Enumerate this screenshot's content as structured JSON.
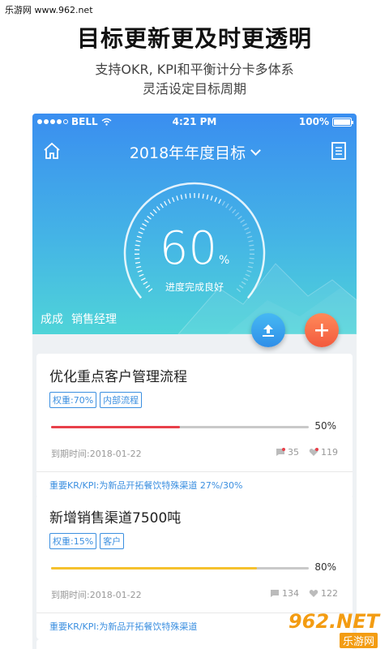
{
  "watermark": {
    "top_text": "乐游网 www.962.net",
    "logo_main": "962.NET",
    "logo_sub": "乐游网"
  },
  "promo": {
    "title": "目标更新更及时更透明",
    "subtitle_line1": "支持OKR, KPI和平衡计分卡多体系",
    "subtitle_line2": "灵活设定目标周期"
  },
  "status_bar": {
    "carrier": "BELL",
    "time": "4:21 PM",
    "battery": "100%"
  },
  "nav": {
    "title": "2018年年度目标",
    "home_icon": "home-icon",
    "doc_icon": "document-icon"
  },
  "gauge": {
    "value": "60",
    "unit": "%",
    "label": "进度完成良好",
    "progress": 0.6
  },
  "owner": {
    "name": "成成",
    "role": "销售经理"
  },
  "fabs": {
    "upload_icon": "upload-icon",
    "add_icon": "plus-icon"
  },
  "cards": [
    {
      "title": "优化重点客户管理流程",
      "tags": [
        "权重:70%",
        "内部流程"
      ],
      "progress": 0.5,
      "progress_label": "50%",
      "bar_color": "#e8404a",
      "deadline": "到期时间:2018-01-22",
      "comments": "35",
      "likes": "119",
      "kr": "重要KR/KPI:为新品开拓餐饮特殊渠道 27%/30%"
    },
    {
      "title": "新增销售渠道7500吨",
      "tags": [
        "权重:15%",
        "客户"
      ],
      "progress": 0.8,
      "progress_label": "80%",
      "bar_color": "#f5c12e",
      "deadline": "到期时间:2018-01-22",
      "comments": "134",
      "likes": "122",
      "kr": "重要KR/KPI:为新品开拓餐饮特殊渠道"
    }
  ],
  "colors": {
    "accent": "#3b8fe0",
    "hero_top": "#3a8ef0",
    "hero_bottom": "#4fd4d8",
    "add_button": "#f35a3d"
  }
}
